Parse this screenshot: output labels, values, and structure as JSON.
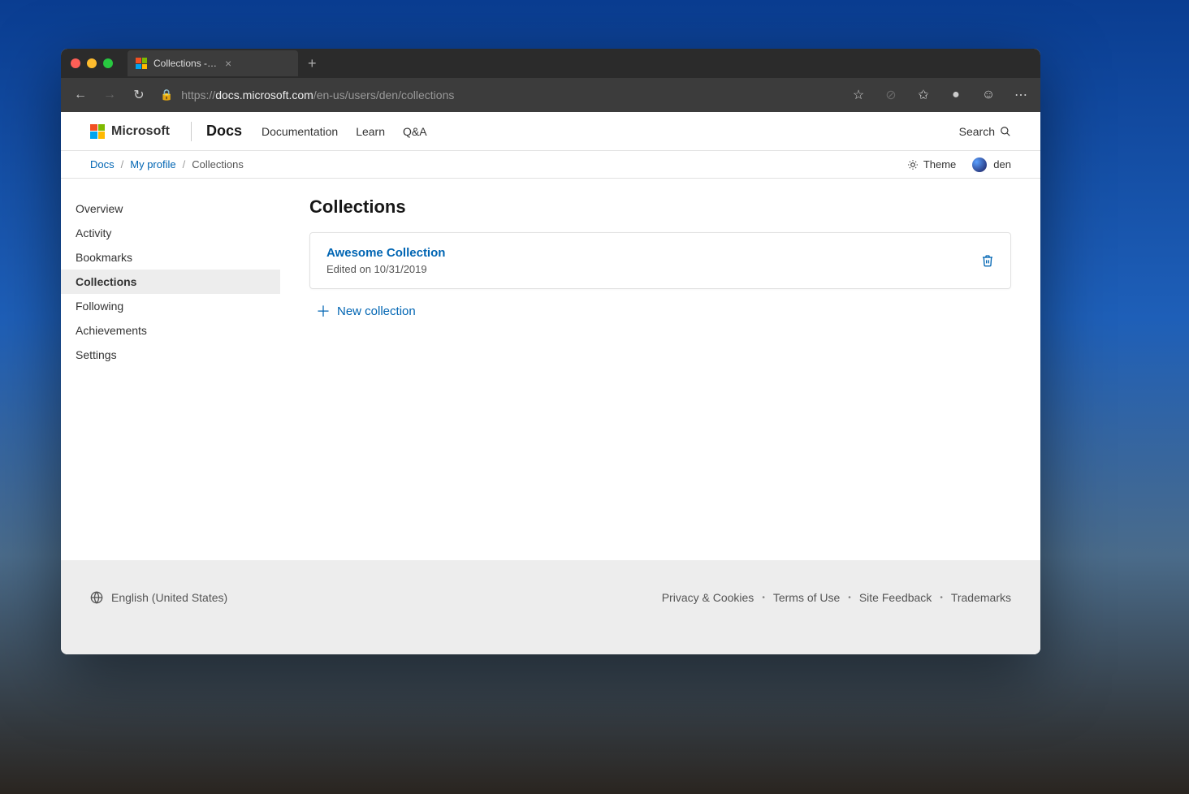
{
  "browser": {
    "tab_title": "Collections - den | Microsoft Do",
    "url_scheme": "https://",
    "url_host": "docs.microsoft.com",
    "url_path": "/en-us/users/den/collections"
  },
  "topnav": {
    "company": "Microsoft",
    "brand": "Docs",
    "links": [
      "Documentation",
      "Learn",
      "Q&A"
    ],
    "search": "Search"
  },
  "crumbs": {
    "root": "Docs",
    "profile": "My profile",
    "current": "Collections",
    "theme": "Theme",
    "username": "den"
  },
  "sidebar": {
    "items": [
      "Overview",
      "Activity",
      "Bookmarks",
      "Collections",
      "Following",
      "Achievements",
      "Settings"
    ],
    "active_index": 3
  },
  "main": {
    "heading": "Collections",
    "card": {
      "title": "Awesome Collection",
      "meta": "Edited on 10/31/2019"
    },
    "new_label": "New collection"
  },
  "footer": {
    "language": "English (United States)",
    "links": [
      "Privacy & Cookies",
      "Terms of Use",
      "Site Feedback",
      "Trademarks"
    ]
  }
}
